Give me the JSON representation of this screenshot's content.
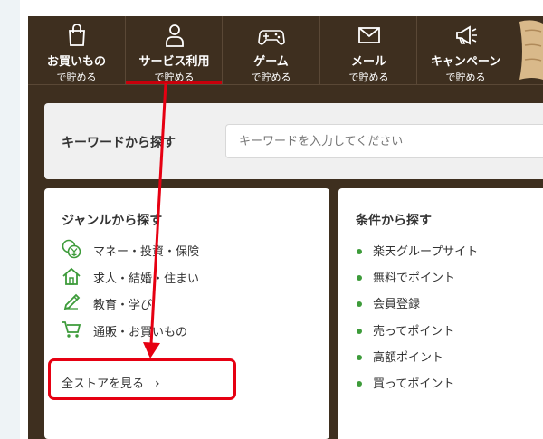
{
  "nav": {
    "items": [
      {
        "label": "お買いもの",
        "sub": "で貯める"
      },
      {
        "label": "サービス利用",
        "sub": "で貯める"
      },
      {
        "label": "ゲーム",
        "sub": "で貯める"
      },
      {
        "label": "メール",
        "sub": "で貯める"
      },
      {
        "label": "キャンペーン",
        "sub": "で貯める"
      }
    ],
    "active_index": 1
  },
  "search": {
    "label": "キーワードから探す",
    "placeholder": "キーワードを入力してください"
  },
  "genre": {
    "title": "ジャンルから探す",
    "items": [
      {
        "label": "マネー・投資・保険",
        "icon": "yen-coins-icon"
      },
      {
        "label": "求人・結婚・住まい",
        "icon": "house-icon"
      },
      {
        "label": "教育・学び",
        "icon": "pencil-icon"
      },
      {
        "label": "通販・お買いもの",
        "icon": "cart-icon"
      }
    ],
    "all_stores": "全ストアを見る",
    "chevron": "›"
  },
  "conditions": {
    "title": "条件から探す",
    "items": [
      "楽天グループサイト",
      "無料でポイント",
      "会員登録",
      "売ってポイント",
      "高額ポイント",
      "買ってポイント"
    ]
  },
  "colors": {
    "panel_bg": "#3e2f1f",
    "accent_red": "#e60012",
    "active_underline": "#c8000b",
    "icon_green": "#3d9b3a"
  }
}
